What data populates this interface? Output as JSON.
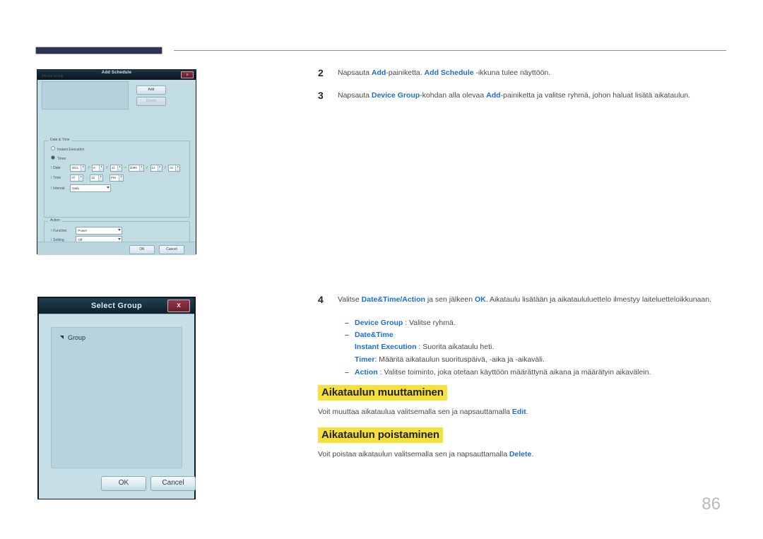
{
  "page": {
    "number": "86",
    "accent_blue": "#1b6fd0",
    "highlight_yellow": "#f5e03c",
    "header_block_color": "#2e3352"
  },
  "steps": [
    {
      "number": "2",
      "segments": [
        {
          "text": "Napsauta ",
          "style": "plain"
        },
        {
          "text": "Add",
          "style": "bold-blue"
        },
        {
          "text": "-painiketta. ",
          "style": "plain"
        },
        {
          "text": "Add Schedule",
          "style": "bold-blue"
        },
        {
          "text": " -ikkuna tulee näyttöön.",
          "style": "plain"
        }
      ]
    },
    {
      "number": "3",
      "segments": [
        {
          "text": "Napsauta ",
          "style": "plain"
        },
        {
          "text": "Device Group",
          "style": "bold-blue"
        },
        {
          "text": "-kohdan alla olevaa ",
          "style": "plain"
        },
        {
          "text": "Add",
          "style": "bold-blue"
        },
        {
          "text": "-painiketta ja valitse ryhmä, johon haluat lisätä aikataulun.",
          "style": "plain"
        }
      ]
    }
  ],
  "step4": {
    "number": "4",
    "lead_segments": [
      {
        "text": "Valitse ",
        "style": "plain"
      },
      {
        "text": "Date&Time/Action",
        "style": "bold-blue"
      },
      {
        "text": " ja sen jälkeen ",
        "style": "plain"
      },
      {
        "text": "OK",
        "style": "bold-blue"
      },
      {
        "text": ". Aikataulu lisätään ja aikataululuettelo ilmestyy laiteluetteloikkunaan.",
        "style": "plain"
      }
    ],
    "bullets": [
      {
        "dash": "–",
        "label": "Device Group",
        "rest": " : Valitse ryhmä."
      },
      {
        "dash": "–",
        "label": "Date&Time",
        "rest": ""
      },
      {
        "dash": "–",
        "label": "Action",
        "rest": " : Valitse toiminto, joka otetaan käyttöön määrättynä aikana ja määrätyin aikavälein."
      }
    ],
    "sub_lines": [
      {
        "label": "Instant Execution",
        "rest": " : Suorita aikataulu heti."
      },
      {
        "label": "Timer",
        "rest": ": Määritä aikataulun suorituspäivä, -aika ja -aikaväli."
      }
    ]
  },
  "sections": [
    {
      "heading": "Aikataulun muuttaminen",
      "body_segments": [
        {
          "text": "Voit muuttaa aikataulua valitsemalla sen ja napsauttamalla ",
          "style": "plain"
        },
        {
          "text": "Edit",
          "style": "bold-blue"
        },
        {
          "text": ".",
          "style": "plain"
        }
      ]
    },
    {
      "heading": "Aikataulun poistaminen",
      "body_segments": [
        {
          "text": "Voit poistaa aikataulun valitsemalla sen ja napsauttamalla ",
          "style": "plain"
        },
        {
          "text": "Delete",
          "style": "bold-blue"
        },
        {
          "text": ".",
          "style": "plain"
        }
      ]
    }
  ],
  "add_schedule_dialog": {
    "title": "Add Schedule",
    "close_label": "x",
    "device_group": {
      "label": "Device Group",
      "add_button": "Add",
      "delete_button": "Delete"
    },
    "date_time": {
      "group_label": "Date & Time",
      "instant_execution_label": "Instant Execution",
      "timer_label": "Timer",
      "date_label": "Date",
      "date_start_year": "2011",
      "date_start_month": "8",
      "date_start_day": "11",
      "date_range_sep": "~",
      "date_end_year": "2099",
      "date_end_month": "12",
      "date_end_day": "31",
      "time_label": "Time",
      "time_hour": "07",
      "time_minute": "32",
      "time_ampm": "PM",
      "interval_label": "Interval",
      "interval_value": "Daily"
    },
    "action": {
      "group_label": "Action",
      "function_label": "Function",
      "function_value": "Power",
      "setting_label": "Setting",
      "setting_value": "Off"
    },
    "buttons": {
      "ok": "OK",
      "cancel": "Cancel"
    }
  },
  "select_group_dialog": {
    "title": "Select Group",
    "close_label": "x",
    "tree_root": "Group",
    "buttons": {
      "ok": "OK",
      "cancel": "Cancel"
    }
  }
}
